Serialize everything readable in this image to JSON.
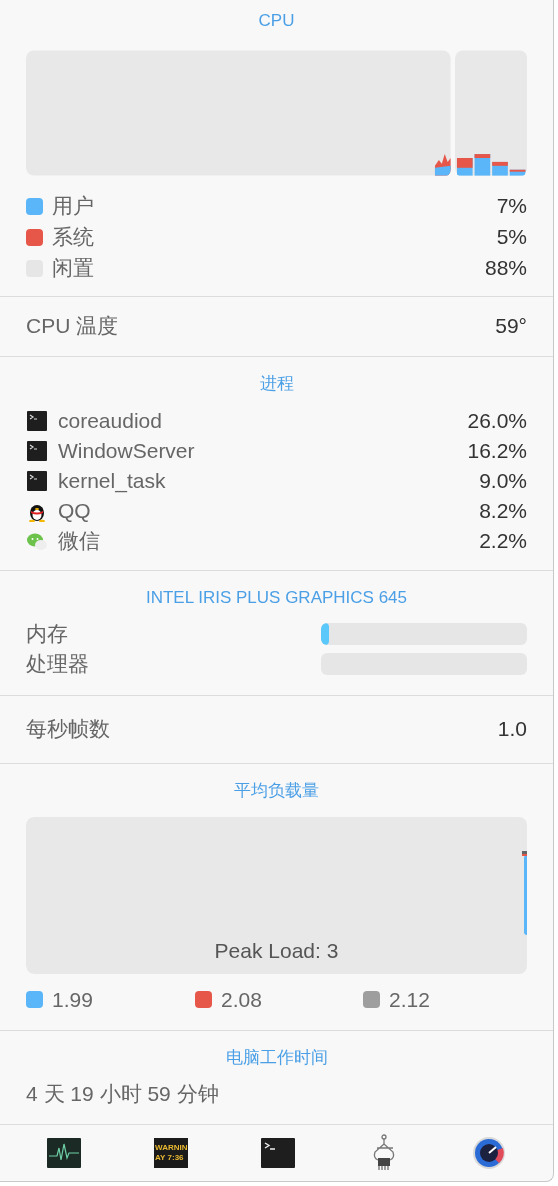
{
  "cpu": {
    "title": "CPU",
    "legend": [
      {
        "label": "用户",
        "value": "7%",
        "color": "#5ab6f8"
      },
      {
        "label": "系统",
        "value": "5%",
        "color": "#e6574a"
      },
      {
        "label": "闲置",
        "value": "88%",
        "color": "#e6e6e6"
      }
    ]
  },
  "cpu_temperature": {
    "label": "CPU 温度",
    "value": "59°"
  },
  "processes": {
    "title": "进程",
    "items": [
      {
        "kind": "terminal",
        "name": "coreaudiod",
        "value": "26.0%"
      },
      {
        "kind": "terminal",
        "name": "WindowServer",
        "value": "16.2%"
      },
      {
        "kind": "terminal",
        "name": "kernel_task",
        "value": "9.0%"
      },
      {
        "kind": "penguin",
        "name": "QQ",
        "value": "8.2%"
      },
      {
        "kind": "chat",
        "name": "微信",
        "value": "2.2%"
      }
    ]
  },
  "gpu": {
    "title": "INTEL IRIS PLUS GRAPHICS 645",
    "meters": [
      {
        "label": "内存",
        "level": 0.04
      },
      {
        "label": "处理器",
        "level": 0
      }
    ]
  },
  "fps": {
    "label": "每秒帧数",
    "value": "1.0"
  },
  "load_average": {
    "title": "平均负载量",
    "peak": "Peak Load: 3",
    "legend": [
      {
        "value": "1.99",
        "color": "#5ab6f8"
      },
      {
        "value": "2.08",
        "color": "#e6574a"
      },
      {
        "value": "2.12",
        "color": "#9e9e9e"
      }
    ]
  },
  "uptime": {
    "title": "电脑工作时间",
    "value": "4 天 19 小时 59 分钟"
  },
  "toolbar": [
    {
      "kind": "activity"
    },
    {
      "kind": "console",
      "lines": [
        "WARNIN",
        "AY 7:36"
      ]
    },
    {
      "kind": "terminal"
    },
    {
      "kind": "system-info"
    },
    {
      "kind": "gauge"
    }
  ]
}
